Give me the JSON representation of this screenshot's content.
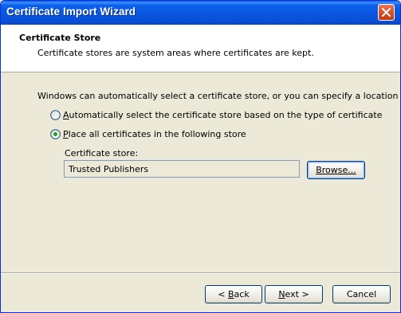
{
  "window": {
    "title": "Certificate Import Wizard"
  },
  "header": {
    "title": "Certificate Store",
    "subtitle": "Certificate stores are system areas where certificates are kept."
  },
  "body": {
    "intro": "Windows can automatically select a certificate store, or you can specify a location for",
    "options": [
      {
        "mnemonic": "A",
        "rest": "utomatically select the certificate store based on the type of certificate",
        "selected": false
      },
      {
        "mnemonic": "P",
        "rest": "lace all certificates in the following store",
        "selected": true
      }
    ],
    "store_label": "Certificate store:",
    "store_value": "Trusted Publishers",
    "browse_label": "Browse..."
  },
  "footer": {
    "back": {
      "prefix": "< ",
      "mnemonic": "B",
      "rest": "ack"
    },
    "next": {
      "mnemonic": "N",
      "rest": "ext >"
    },
    "cancel": "Cancel"
  },
  "colors": {
    "titlebar": "#0a56df",
    "dialog_bg": "#ece9d8",
    "close_button": "#d9522c",
    "radio_dot": "#21a121"
  }
}
